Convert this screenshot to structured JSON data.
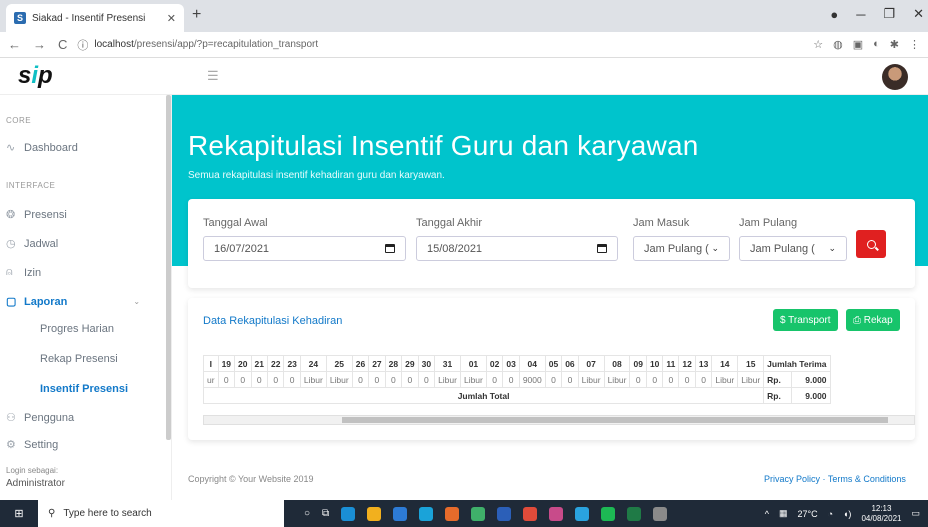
{
  "browser": {
    "tab_title": "Siakad - Insentif Presensi",
    "favicon_letter": "S",
    "url_host": "localhost",
    "url_path": "/presensi/app/?p=recapitulation_transport"
  },
  "app": {
    "logo_text_a": "s",
    "logo_text_b": "i",
    "logo_text_c": "p"
  },
  "sidebar": {
    "section_core": "CORE",
    "section_interface": "INTERFACE",
    "items": {
      "dashboard": "Dashboard",
      "presensi": "Presensi",
      "jadwal": "Jadwal",
      "izin": "Izin",
      "laporan": "Laporan",
      "pengguna": "Pengguna",
      "setting": "Setting"
    },
    "sub_items": {
      "progres": "Progres Harian",
      "rekap": "Rekap Presensi",
      "insentif": "Insentif Presensi"
    },
    "login_label": "Login sebagai:",
    "login_user": "Administrator"
  },
  "hero": {
    "title": "Rekapitulasi Insentif Guru dan karyawan",
    "subtitle": "Semua rekapitulasi insentif kehadiran guru dan karyawan."
  },
  "filter": {
    "tanggal_awal_label": "Tanggal Awal",
    "tanggal_awal_value": "16/07/2021",
    "tanggal_akhir_label": "Tanggal Akhir",
    "tanggal_akhir_value": "15/08/2021",
    "jam_masuk_label": "Jam Masuk",
    "jam_masuk_value": "Jam Pulang (",
    "jam_pulang_label": "Jam Pulang",
    "jam_pulang_value": "Jam Pulang ("
  },
  "card": {
    "title": "Data Rekapitulasi Kehadiran",
    "transport_btn": "$ Transport",
    "rekap_btn": "⎙ Rekap"
  },
  "table": {
    "headers": [
      "I",
      "19",
      "20",
      "21",
      "22",
      "23",
      "24",
      "25",
      "26",
      "27",
      "28",
      "29",
      "30",
      "31",
      "01",
      "02",
      "03",
      "04",
      "05",
      "06",
      "07",
      "08",
      "09",
      "10",
      "11",
      "12",
      "13",
      "14",
      "15",
      "Jumlah Terima"
    ],
    "row": [
      "ur",
      "0",
      "0",
      "0",
      "0",
      "0",
      "Libur",
      "Libur",
      "0",
      "0",
      "0",
      "0",
      "0",
      "Libur",
      "Libur",
      "0",
      "0",
      "9000",
      "0",
      "0",
      "Libur",
      "Libur",
      "0",
      "0",
      "0",
      "0",
      "0",
      "Libur",
      "Libur",
      "Rp.",
      "9.000"
    ],
    "total_label": "Jumlah Total",
    "total_currency": "Rp.",
    "total_value": "9.000"
  },
  "footer": {
    "copyright": "Copyright © Your Website 2019",
    "links": "Privacy Policy · Terms & Conditions"
  },
  "taskbar": {
    "search_placeholder": "Type here to search",
    "temp": "27°C",
    "time": "12:13",
    "date": "04/08/2021"
  }
}
